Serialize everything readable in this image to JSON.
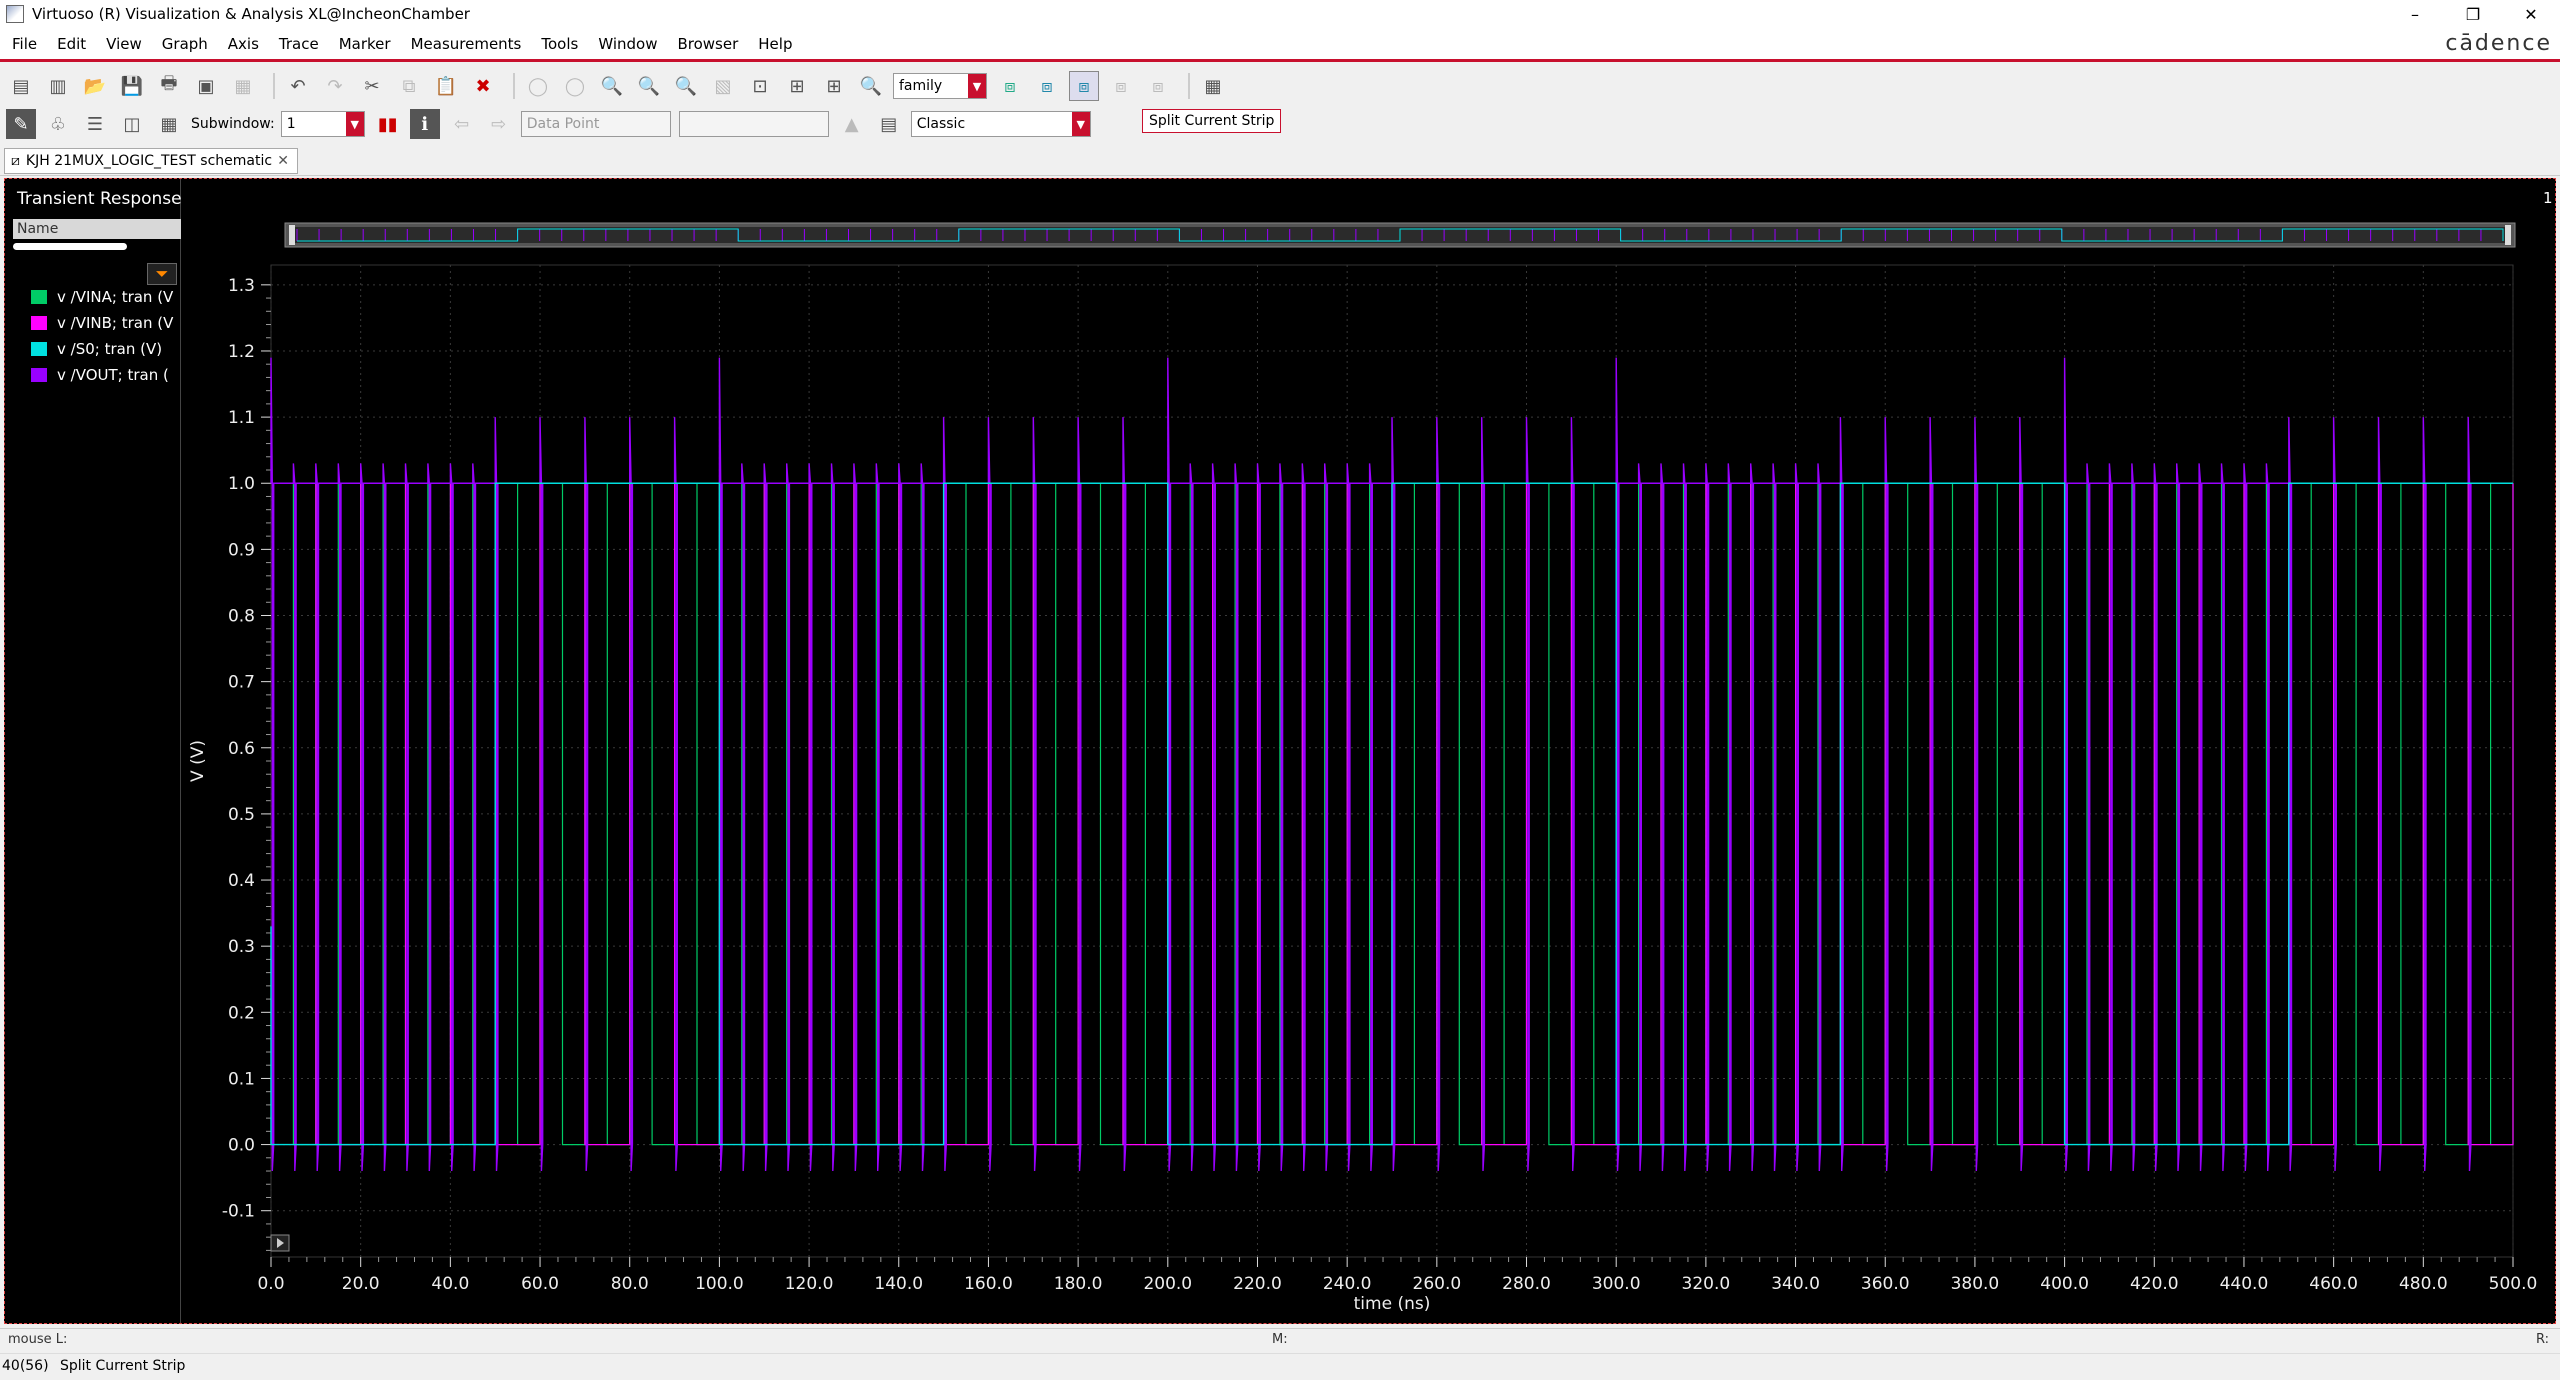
{
  "window": {
    "title": "Virtuoso (R) Visualization & Analysis XL@IncheonChamber",
    "controls": [
      "–",
      "❐",
      "✕"
    ]
  },
  "menubar": {
    "items": [
      "File",
      "Edit",
      "View",
      "Graph",
      "Axis",
      "Trace",
      "Marker",
      "Measurements",
      "Tools",
      "Window",
      "Browser",
      "Help"
    ],
    "brand": "cādence"
  },
  "toolbar": {
    "family_value": "family",
    "subwindow_label": "Subwindow:",
    "subwindow_value": "1",
    "marker_type_value": "Data Point",
    "style_value": "Classic",
    "tooltip": "Split Current Strip"
  },
  "tab": {
    "label": "KJH 21MUX_LOGIC_TEST schematic"
  },
  "sidebar": {
    "title": "Transient Response",
    "column_header": "Name",
    "traces": [
      {
        "label": "v /VINA; tran (V",
        "color": "#00cc66"
      },
      {
        "label": "v /VINB; tran (V",
        "color": "#ff00ff"
      },
      {
        "label": "v /S0; tran (V)",
        "color": "#00e0e0"
      },
      {
        "label": "v /VOUT; tran (",
        "color": "#9900ff"
      }
    ]
  },
  "strip_number": "1",
  "chart_data": {
    "type": "line",
    "xlabel": "time (ns)",
    "ylabel": "V (V)",
    "xlim": [
      0,
      500
    ],
    "ylim": [
      -0.17,
      1.33
    ],
    "xticks": [
      "0.0",
      "20.0",
      "40.0",
      "60.0",
      "80.0",
      "100.0",
      "120.0",
      "140.0",
      "160.0",
      "180.0",
      "200.0",
      "220.0",
      "240.0",
      "260.0",
      "280.0",
      "300.0",
      "320.0",
      "340.0",
      "360.0",
      "380.0",
      "400.0",
      "420.0",
      "440.0",
      "460.0",
      "480.0",
      "500.0"
    ],
    "yticks": [
      "1.3",
      "1.2",
      "1.1",
      "1.0",
      "0.9",
      "0.8",
      "0.7",
      "0.6",
      "0.5",
      "0.4",
      "0.3",
      "0.2",
      "0.1",
      "0.0",
      "-0.1"
    ],
    "grid": true,
    "series": [
      {
        "name": "v /VINA; tran (V)",
        "color": "#00cc66",
        "description": "square wave 0/1 V, period 10 ns"
      },
      {
        "name": "v /VINB; tran (V)",
        "color": "#ff00ff",
        "description": "square wave 0/1 V, period 20 ns"
      },
      {
        "name": "v /S0; tran (V)",
        "color": "#00e0e0",
        "description": "high (1.0 V) 50–100, 150–200, 250–300, 350–400, 450–500 ns; low otherwise"
      },
      {
        "name": "v /VOUT; tran (V)",
        "color": "#9900ff",
        "description": "switching output with overshoot to ~1.03–1.19 V and undershoot to ~-0.04 V"
      }
    ],
    "s0_high_intervals": [
      [
        50,
        100
      ],
      [
        150,
        200
      ],
      [
        250,
        300
      ],
      [
        350,
        400
      ],
      [
        450,
        500
      ]
    ],
    "vout_fast_period_ns": 5,
    "vout_slow_period_ns": 10
  },
  "statusbar": {
    "mouse_left": "mouse L:",
    "mouse_middle": "M:",
    "mouse_right": "R:",
    "counter": "40(56)",
    "message": "Split Current Strip"
  }
}
